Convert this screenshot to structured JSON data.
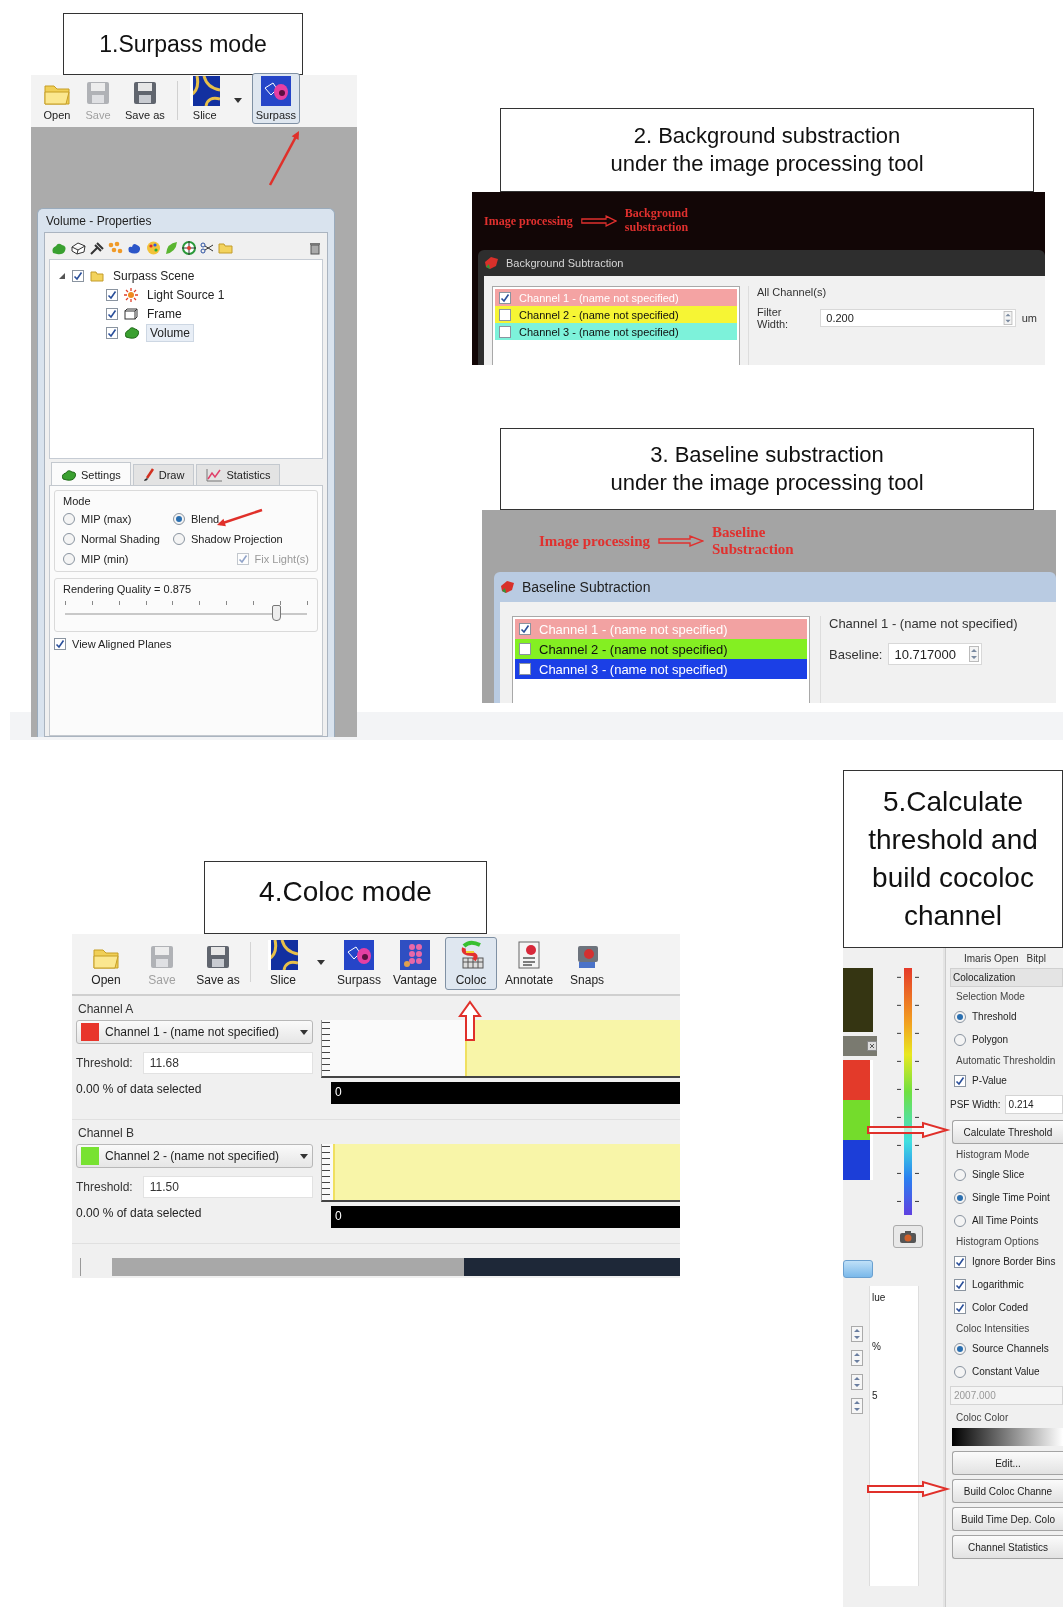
{
  "surpass_panel": {
    "caption": "1.Surpass mode",
    "toolbar": [
      {
        "kind": "open",
        "label": "Open",
        "disabled": false,
        "selected": false
      },
      {
        "kind": "save",
        "label": "Save",
        "disabled": true,
        "selected": false
      },
      {
        "kind": "saveas",
        "label": "Save as",
        "disabled": false,
        "selected": false
      },
      {
        "kind": "slice",
        "label": "Slice",
        "disabled": false,
        "selected": false
      },
      {
        "kind": "surpass",
        "label": "Surpass",
        "disabled": false,
        "selected": true
      }
    ],
    "properties": {
      "title": "Volume - Properties",
      "tree": [
        {
          "kind": "folder",
          "label": "Surpass Scene",
          "checked": true,
          "expanded": true,
          "selected": false,
          "children": [
            {
              "kind": "light",
              "label": "Light Source 1",
              "checked": true,
              "selected": false
            },
            {
              "kind": "frame",
              "label": "Frame",
              "checked": true,
              "selected": false
            },
            {
              "kind": "volume",
              "label": "Volume",
              "checked": true,
              "selected": true
            }
          ]
        }
      ],
      "tabs": [
        {
          "kind": "settings",
          "label": "Settings",
          "selected": true
        },
        {
          "kind": "draw",
          "label": "Draw",
          "selected": false
        },
        {
          "kind": "statistics",
          "label": "Statistics",
          "selected": false
        }
      ],
      "mode": {
        "title": "Mode",
        "options": [
          {
            "kind": "radio",
            "label": "MIP (max)",
            "selected": false,
            "disabled": false
          },
          {
            "kind": "radio",
            "label": "Blend",
            "selected": true,
            "disabled": false
          },
          {
            "kind": "radio",
            "label": "Normal Shading",
            "selected": false,
            "disabled": false
          },
          {
            "kind": "radio",
            "label": "Shadow Projection",
            "selected": false,
            "disabled": false
          },
          {
            "kind": "radio",
            "label": "MIP (min)",
            "selected": false,
            "disabled": false
          },
          {
            "kind": "checkbox",
            "label": "Fix Light(s)",
            "checked": true,
            "disabled": true
          }
        ]
      },
      "quality": {
        "label": "Rendering Quality = 0.875",
        "level": 0.87
      },
      "view_aligned": {
        "label": "View Aligned Planes",
        "checked": true
      }
    }
  },
  "background_panel": {
    "caption_lines": [
      "2. Background substraction",
      "under the image processing tool"
    ],
    "annotation": {
      "from": "Image processing",
      "to": "Background substraction"
    },
    "dialog": {
      "title": "Background Subtraction",
      "channels": [
        {
          "label": "Channel 1 - (name not specified)",
          "color": "#f4a3a3",
          "checked": true
        },
        {
          "label": "Channel 2 - (name not specified)",
          "color": "#f6f534",
          "checked": false
        },
        {
          "label": "Channel 3 - (name not specified)",
          "color": "#7df2da",
          "checked": false
        }
      ],
      "group_title": "All Channel(s)",
      "field_label": "Filter Width:",
      "field_value": "0.200",
      "unit": "um"
    }
  },
  "baseline_panel": {
    "caption_lines": [
      "3. Baseline substraction",
      "under the image processing tool"
    ],
    "annotation": {
      "from": "Image processing",
      "to": "Baseline Substraction"
    },
    "dialog": {
      "title": "Baseline Subtraction",
      "channels": [
        {
          "label": "Channel 1 - (name not specified)",
          "color": "#f2a2a2",
          "checked": true
        },
        {
          "label": "Channel 2 - (name not specified)",
          "color": "#84ef22",
          "checked": false
        },
        {
          "label": "Channel 3 - (name not specified)",
          "color": "#1b3fe6",
          "checked": false
        }
      ],
      "group_title": "Channel 1 - (name not specified)",
      "field_label": "Baseline:",
      "field_value": "10.717000"
    }
  },
  "coloc_panel": {
    "caption": "4.Coloc mode",
    "toolbar": [
      {
        "kind": "open",
        "label": "Open",
        "disabled": false,
        "selected": false
      },
      {
        "kind": "save",
        "label": "Save",
        "disabled": true,
        "selected": false
      },
      {
        "kind": "saveas",
        "label": "Save as",
        "disabled": false,
        "selected": false
      },
      {
        "kind": "slice",
        "label": "Slice",
        "disabled": false,
        "selected": false
      },
      {
        "kind": "surpass",
        "label": "Surpass",
        "disabled": false,
        "selected": false
      },
      {
        "kind": "vantage",
        "label": "Vantage",
        "disabled": false,
        "selected": false
      },
      {
        "kind": "coloc",
        "label": "Coloc",
        "disabled": false,
        "selected": true
      },
      {
        "kind": "annotate",
        "label": "Annotate",
        "disabled": false,
        "selected": false
      },
      {
        "kind": "snapshot",
        "label": "Snaps",
        "disabled": false,
        "selected": false
      }
    ],
    "channels": [
      {
        "title": "Channel A",
        "channel": "Channel 1 - (name not specified)",
        "color": "#e8352b",
        "threshold_label": "Threshold:",
        "threshold": "11.68",
        "selected_text": "0.00 % of data selected",
        "level": 0.6,
        "count": "0"
      },
      {
        "title": "Channel B",
        "channel": "Channel 2 - (name not specified)",
        "color": "#78e232",
        "threshold_label": "Threshold:",
        "threshold": "11.50",
        "selected_text": "0.00 % of data selected",
        "level": 0.97,
        "count": "0"
      }
    ]
  },
  "threshold_panel": {
    "caption_lines": [
      "5.Calculate",
      "threshold and",
      "build cocoloc",
      "channel"
    ],
    "menu": [
      "Imaris Open",
      "Bitpl"
    ],
    "fragments": [
      "lue",
      "%",
      "5"
    ],
    "section": "Colocalization",
    "controls": [
      {
        "kind": "heading",
        "label": "Selection Mode"
      },
      {
        "kind": "radio",
        "label": "Threshold",
        "selected": true
      },
      {
        "kind": "radio",
        "label": "Polygon",
        "selected": false
      },
      {
        "kind": "heading",
        "label": "Automatic Thresholdin"
      },
      {
        "kind": "checkbox",
        "label": "P-Value",
        "checked": true
      },
      {
        "kind": "field",
        "label": "PSF Width:",
        "value": "0.214",
        "disabled": false
      },
      {
        "kind": "button",
        "label": "Calculate Threshold"
      },
      {
        "kind": "heading",
        "label": "Histogram Mode"
      },
      {
        "kind": "radio",
        "label": "Single Slice",
        "selected": false
      },
      {
        "kind": "radio",
        "label": "Single Time Point",
        "selected": true
      },
      {
        "kind": "radio",
        "label": "All Time Points",
        "selected": false
      },
      {
        "kind": "heading",
        "label": "Histogram Options"
      },
      {
        "kind": "checkbox",
        "label": "Ignore Border Bins",
        "checked": true
      },
      {
        "kind": "checkbox",
        "label": "Logarithmic",
        "checked": true
      },
      {
        "kind": "checkbox",
        "label": "Color Coded",
        "checked": true
      },
      {
        "kind": "heading",
        "label": "Coloc Intensities"
      },
      {
        "kind": "radio",
        "label": "Source Channels",
        "selected": true
      },
      {
        "kind": "radio",
        "label": "Constant Value",
        "selected": false
      },
      {
        "kind": "field",
        "value": "2007.000",
        "disabled": true
      },
      {
        "kind": "heading",
        "label": "Coloc Color"
      },
      {
        "kind": "gradient"
      },
      {
        "kind": "button",
        "label": "Edit..."
      },
      {
        "kind": "button",
        "label": "Build Coloc Channe"
      },
      {
        "kind": "button",
        "label": "Build Time Dep. Colo"
      },
      {
        "kind": "button",
        "label": "Channel Statistics"
      }
    ]
  }
}
